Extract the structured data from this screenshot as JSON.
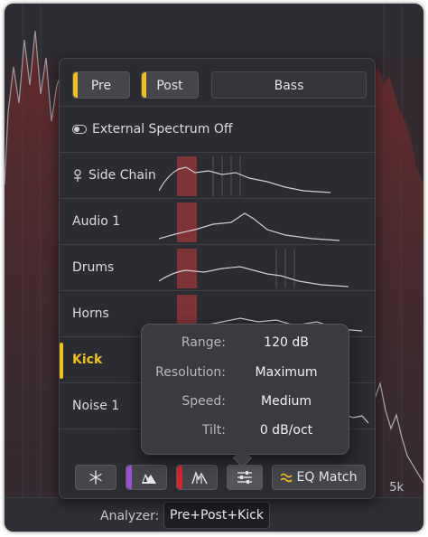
{
  "panel": {
    "buttons": {
      "pre_label": "Pre",
      "post_label": "Post",
      "bass_label": "Bass"
    },
    "rows": [
      {
        "label": "External Spectrum Off",
        "icon": "toggle-icon"
      },
      {
        "label": "Side Chain",
        "icon": "sidechain-key-icon"
      },
      {
        "label": "Audio 1"
      },
      {
        "label": "Drums"
      },
      {
        "label": "Horns"
      },
      {
        "label": "Kick",
        "active": true
      },
      {
        "label": "Noise 1"
      }
    ]
  },
  "tooltip": {
    "items": [
      {
        "key": "Range:",
        "value": "120 dB"
      },
      {
        "key": "Resolution:",
        "value": "Maximum"
      },
      {
        "key": "Speed:",
        "value": "Medium"
      },
      {
        "key": "Tilt:",
        "value": "0 dB/oct"
      }
    ]
  },
  "toolbar": {
    "freeze_icon": "snowflake-icon",
    "eq_match_label": "EQ Match",
    "eq_match_icon": "approx-icon",
    "settings_icon": "sliders-icon",
    "purple_accent": "#9b4fd6",
    "red_accent": "#d9262e"
  },
  "graph": {
    "freq_label": "5k"
  },
  "analyzer": {
    "label": "Analyzer:",
    "value": "Pre+Post+Kick"
  },
  "colors": {
    "accent": "#f2c01a",
    "spectrum_red": "#c23a3a"
  }
}
